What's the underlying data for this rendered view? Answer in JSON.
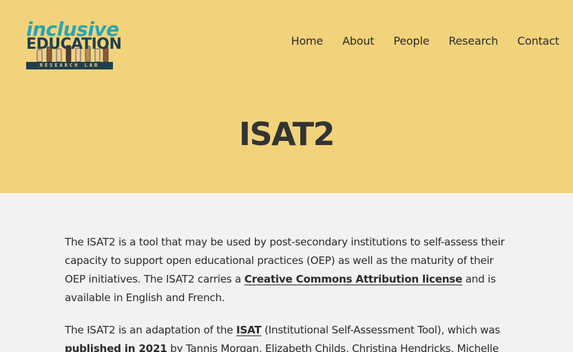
{
  "logo": {
    "line1": "inclusive",
    "line2": "EDUCATION",
    "line3": "RESEARCH LAB"
  },
  "nav": {
    "items": [
      "Home",
      "About",
      "People",
      "Research",
      "Contact"
    ]
  },
  "page": {
    "title": "ISAT2"
  },
  "content": {
    "p1": {
      "before": "The ISAT2 is a tool that may be used by post-secondary institutions to self-assess their capacity to support open educational practices (OEP) as well as the maturity of their OEP initiatives. The ISAT2 carries a ",
      "link": "Creative Commons Attribution license",
      "after": " and is available in English and French."
    },
    "p2": {
      "before": "The ISAT2 is an adaptation of the ",
      "link1": "ISAT",
      "middle": " (Institutional Self-Assessment Tool), which was ",
      "link2": "published in 2021",
      "after": " by Tannis Morgan, Elizabeth Childs, Christina Hendricks, Michelle"
    }
  },
  "colors": {
    "hero_bg": "#f2d37b",
    "body_bg": "#f2f2f2",
    "text": "#2b2b2b",
    "logo_teal": "#29a4b4",
    "logo_navy": "#1f3f4f"
  }
}
